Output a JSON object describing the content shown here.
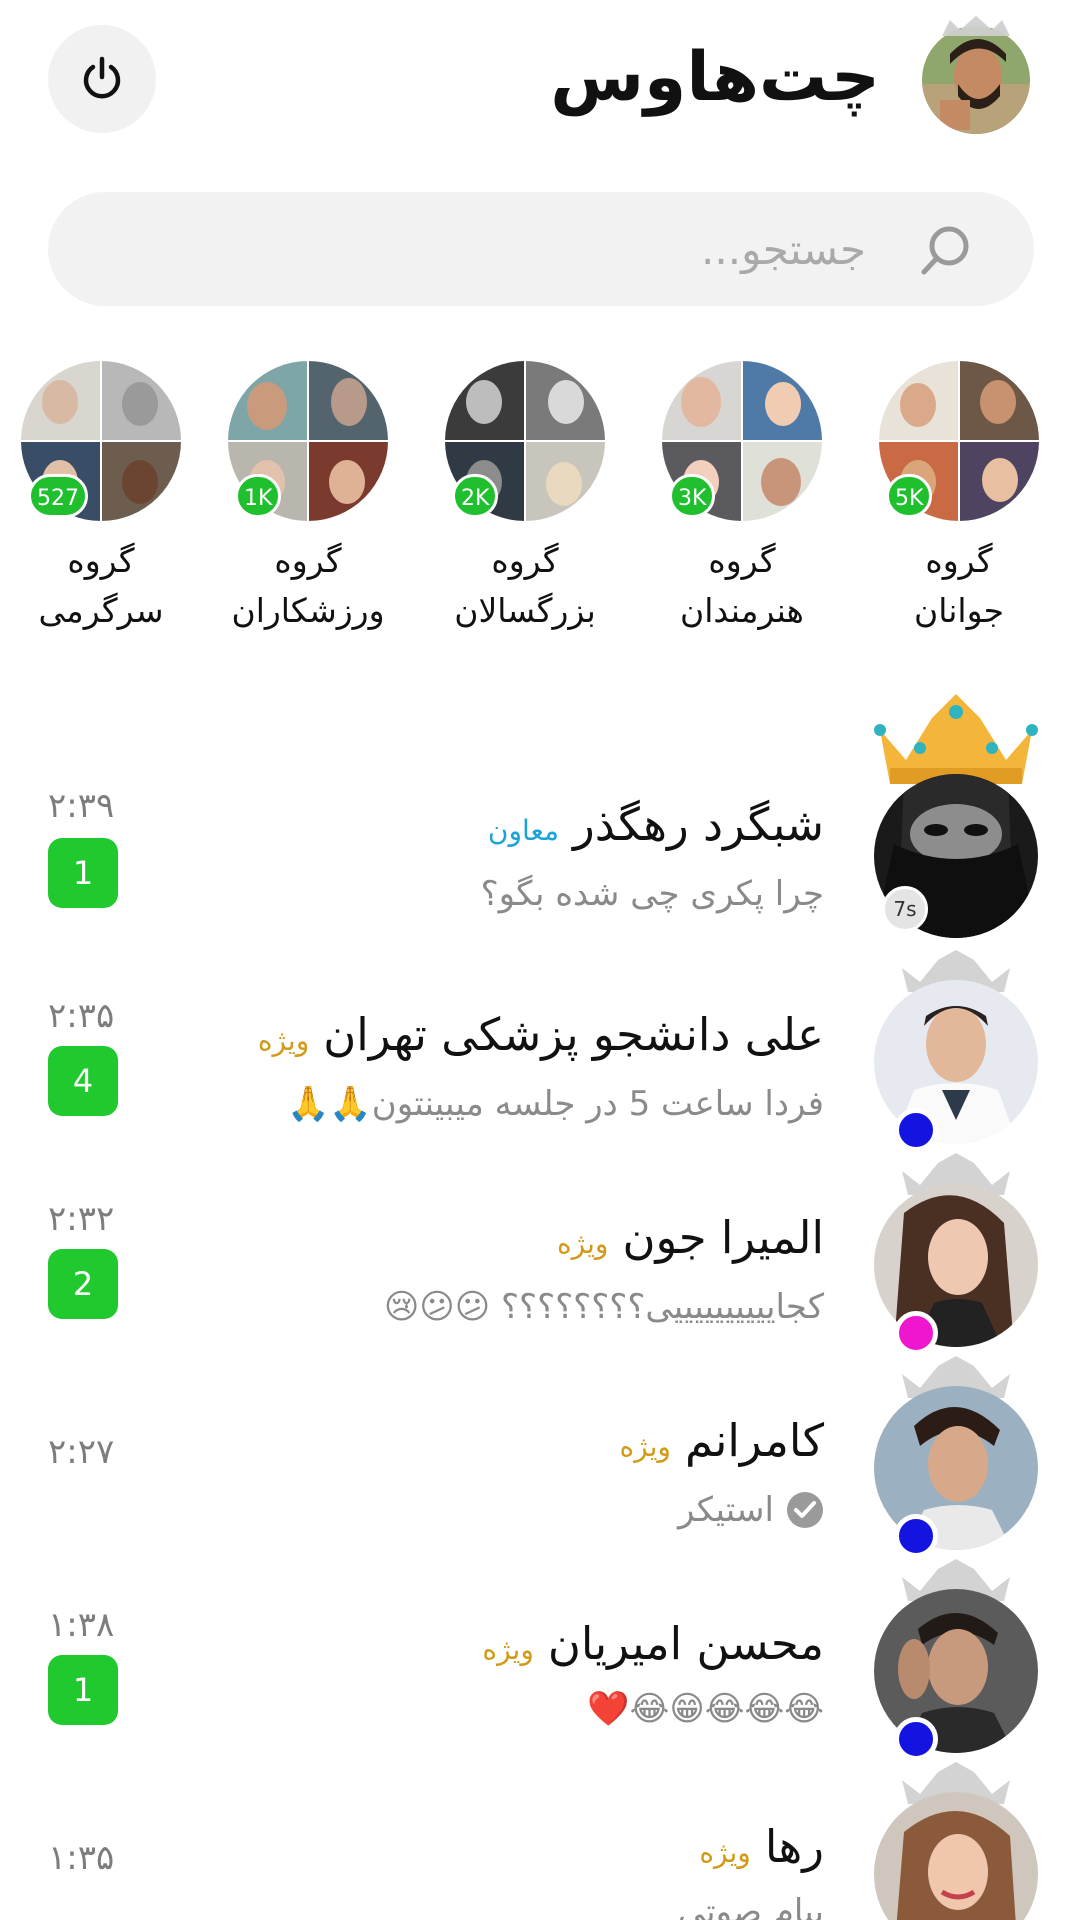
{
  "header": {
    "title": "چت‌هاوس",
    "power_icon": "power-icon",
    "avatar_icon": "user-avatar"
  },
  "search": {
    "placeholder": "جستجو...",
    "icon": "search-icon"
  },
  "groups": [
    {
      "line1": "گروه",
      "line2": "جوانان",
      "count": "5K"
    },
    {
      "line1": "گروه",
      "line2": "هنرمندان",
      "count": "3K"
    },
    {
      "line1": "گروه",
      "line2": "بزرگسالان",
      "count": "2K"
    },
    {
      "line1": "گروه",
      "line2": "ورزشکاران",
      "count": "1K"
    },
    {
      "line1": "گروه",
      "line2": "سرگرمی",
      "count": "527"
    }
  ],
  "chats": [
    {
      "name": "شبگرد رهگذر",
      "tag": "معاون",
      "message": "چرا پکری چی شده بگو؟",
      "time": "۲:۳۹",
      "unread": "1",
      "extra": "7s",
      "status_color": "#e6e6e6"
    },
    {
      "name": "علی دانشجو پزشکی تهران",
      "tag": "ویژه",
      "message": "فردا ساعت 5 در جلسه میبینتون🙏🙏",
      "time": "۲:۳۵",
      "unread": "4",
      "status_color": "#1414e0"
    },
    {
      "name": "المیرا جون",
      "tag": "ویژه",
      "message": "کجاییییییییییی؟؟؟؟؟؟؟؟ 😕😕😢",
      "time": "۲:۳۲",
      "unread": "2",
      "status_color": "#ef16d0"
    },
    {
      "name": "کامرانم",
      "tag": "ویژه",
      "message": "استیکر",
      "time": "۲:۲۷",
      "unread": "",
      "status_color": "#1414e0"
    },
    {
      "name": "محسن امیریان",
      "tag": "ویژه",
      "message": "😂😂😂😁😂❤️",
      "time": "۱:۳۸",
      "unread": "1",
      "status_color": "#1414e0"
    },
    {
      "name": "رها",
      "tag": "ویژه",
      "message": "پیام صوتی",
      "time": "۱:۳۵",
      "unread": "",
      "status_color": "#ef16d0"
    }
  ],
  "colors": {
    "accent_green": "#1fc92e",
    "gold": "#d39a1a",
    "blue_tag": "#1aa3d6"
  }
}
